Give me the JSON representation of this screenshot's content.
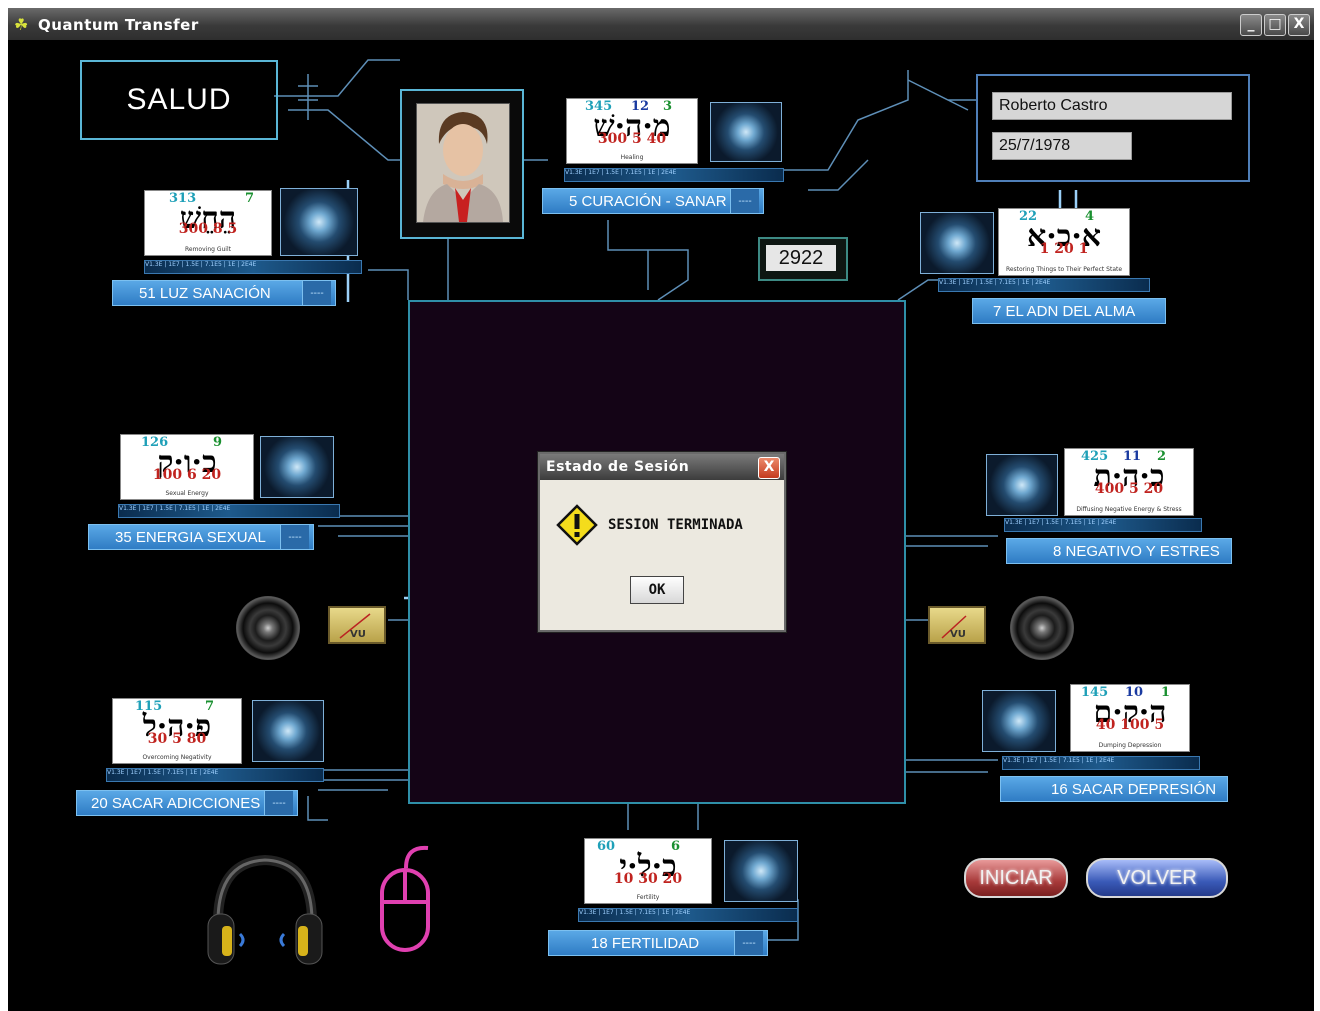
{
  "window": {
    "title": "Quantum Transfer",
    "minimize": "_",
    "maximize": "□",
    "close": "X"
  },
  "program": {
    "name": "SALUD"
  },
  "patient": {
    "name": "Roberto Castro",
    "birthdate": "25/7/1978"
  },
  "counter": {
    "value": "2922"
  },
  "modules": [
    {
      "n1": "313",
      "n2": "7",
      "hebrew": "הֵחֵשׁ",
      "vals": "300  8  5",
      "sub": "Removing Guilt",
      "label": "51 LUZ SANACIÓN"
    },
    {
      "n1": "345",
      "n2": "12",
      "n3": "3",
      "hebrew": "מ·ה·שׁ",
      "vals": "300  5  40",
      "sub": "Healing",
      "label": "5 CURACIÓN - SANAR"
    },
    {
      "n1": "22",
      "n2": "4",
      "hebrew": "א·כ·א",
      "vals": "1  20  1",
      "sub": "Restoring Things to Their Perfect State",
      "label": "7 EL ADN DEL ALMA"
    },
    {
      "n1": "126",
      "n2": "9",
      "hebrew": "כ·ו·ק",
      "vals": "100 6  20",
      "sub": "Sexual Energy",
      "label": "35 ENERGIA SEXUAL"
    },
    {
      "n1": "425",
      "n2": "11",
      "n3": "2",
      "hebrew": "כ·ה·ת",
      "vals": "400  5  20",
      "sub": "Diffusing Negative Energy & Stress",
      "label": "8 NEGATIVO Y ESTRES"
    },
    {
      "n1": "115",
      "n2": "7",
      "hebrew": "פ·ה·ל",
      "vals": "30  5  80",
      "sub": "Overcoming Negativity",
      "label": "20 SACAR ADICCIONES"
    },
    {
      "n1": "145",
      "n2": "10",
      "n3": "1",
      "hebrew": "ה·ק·ם",
      "vals": "40 100  5",
      "sub": "Dumping Depression",
      "label": "16 SACAR DEPRESIÓN"
    },
    {
      "n1": "60",
      "n2": "6",
      "hebrew": "כ·ל·י",
      "vals": "10  30  20",
      "sub": "Fertility",
      "label": "18 FERTILIDAD"
    }
  ],
  "dialog": {
    "title": "Estado de Sesión",
    "close": "X",
    "message": "SESION TERMINADA",
    "ok": "OK"
  },
  "meters": {
    "left_label": "VU",
    "right_label": "VU"
  },
  "buttons": {
    "start": "INICIAR",
    "back": "VOLVER"
  },
  "strip_text": "V1.3E  |  1E7  |  1.5E  |  7.1E5  |  1E  |  2E4E",
  "label_dash": "----",
  "colors": {
    "frame": "#5ab6d6",
    "label": "#2f7cc4",
    "center_bg": "#140416",
    "start_btn": "#b84a4a",
    "back_btn": "#3a5ab8"
  }
}
